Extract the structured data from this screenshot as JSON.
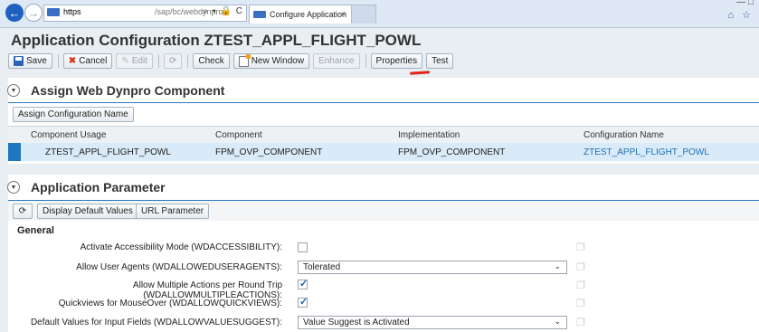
{
  "browser": {
    "address_protocol": "https",
    "address_path": "/sap/bc/webdynpro",
    "address_controls": "⌕ ▾ 🔒 C",
    "tab_title": "Configure Application",
    "tab_close": "×"
  },
  "page": {
    "title": "Application Configuration ZTEST_APPL_FLIGHT_POWL"
  },
  "toolbar": {
    "save": "Save",
    "cancel": "Cancel",
    "edit": "Edit",
    "check": "Check",
    "new_window": "New Window",
    "enhance": "Enhance",
    "properties": "Properties",
    "test": "Test"
  },
  "wd_component": {
    "title": "Assign Web Dynpro Component",
    "assign_button": "Assign Configuration Name",
    "columns": [
      "Component Usage",
      "Component",
      "Implementation",
      "Configuration Name"
    ],
    "row": [
      "ZTEST_APPL_FLIGHT_POWL",
      "FPM_OVP_COMPONENT",
      "FPM_OVP_COMPONENT",
      "ZTEST_APPL_FLIGHT_POWL"
    ]
  },
  "app_params": {
    "title": "Application Parameter",
    "display_defaults": "Display Default Values",
    "url_parameter": "URL Parameter",
    "group": "General",
    "rows": [
      {
        "label": "Activate Accessibility Mode (WDACCESSIBILITY):",
        "type": "checkbox",
        "checked": false
      },
      {
        "label": "Allow User Agents (WDALLOWEDUSERAGENTS):",
        "type": "select",
        "value": "Tolerated"
      },
      {
        "label": "Allow Multiple Actions per Round Trip (WDALLOWMULTIPLEACTIONS):",
        "type": "checkbox",
        "checked": true
      },
      {
        "label": "Quickviews for MouseOver (WDALLOWQUICKVIEWS):",
        "type": "checkbox",
        "checked": true
      },
      {
        "label": "Default Values for Input Fields (WDALLOWVALUESUGGEST):",
        "type": "select",
        "value": "Value Suggest is Activated"
      }
    ]
  },
  "colors": {
    "accent": "#2b78c5",
    "row_selected": "#d9ebf8"
  }
}
